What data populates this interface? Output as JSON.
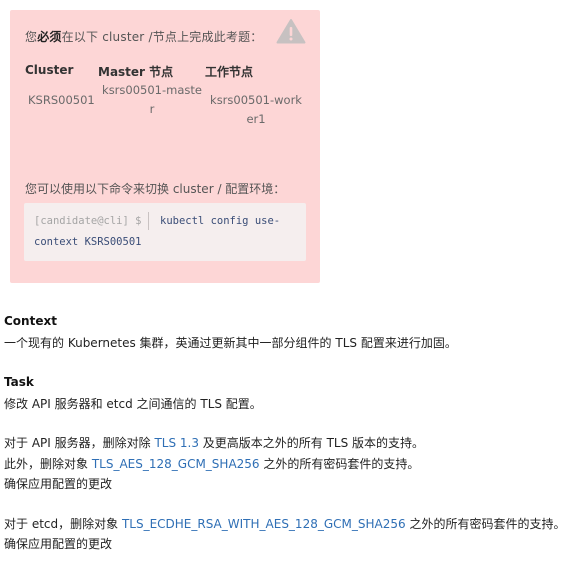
{
  "notice": {
    "line1_prefix": "您",
    "line1_bold": "必须",
    "line1_suffix": "在以下 cluster /节点上完成此考题：",
    "warning_icon": "warning-triangle-icon",
    "table": {
      "headers": [
        "Cluster",
        "Master 节点",
        "工作节点"
      ],
      "row": {
        "cluster": "KSRS00501",
        "master_line1": "ksrs00501-maste",
        "master_line2": "r",
        "worker_line1": "ksrs00501-work",
        "worker_line2": "er1"
      }
    },
    "line2": "您可以使用以下命令来切换 cluster / 配置环境：",
    "command": {
      "prompt": "[candidate@cli] $",
      "text_line1": "kubectl config use-",
      "text_line2": "context KSRS00501"
    }
  },
  "context": {
    "heading": "Context",
    "body": "一个现有的 Kubernetes 集群，英通过更新其中一部分组件的 TLS 配置来进行加固。"
  },
  "task": {
    "heading": "Task",
    "line1": "修改 API 服务器和 etcd 之间通信的 TLS 配置。",
    "api_prefix": "对于 API 服务器，删除对除 ",
    "api_link": "TLS 1.3",
    "api_suffix": " 及更高版本之外的所有 TLS 版本的支持。",
    "cipher_prefix": "此外，删除对象 ",
    "cipher_link": "TLS_AES_128_GCM_SHA256",
    "cipher_suffix": " 之外的所有密码套件的支持。",
    "ensure1": "确保应用配置的更改",
    "etcd_prefix": "对于 etcd，删除对象 ",
    "etcd_link": "TLS_ECDHE_RSA_WITH_AES_128_GCM_SHA256",
    "etcd_suffix": " 之外的所有密码套件的支持。",
    "ensure2": "确保应用配置的更改"
  },
  "colors": {
    "notice_bg": "#fdd6d6",
    "link": "#2f6fb5",
    "command": "#3a4d77"
  }
}
